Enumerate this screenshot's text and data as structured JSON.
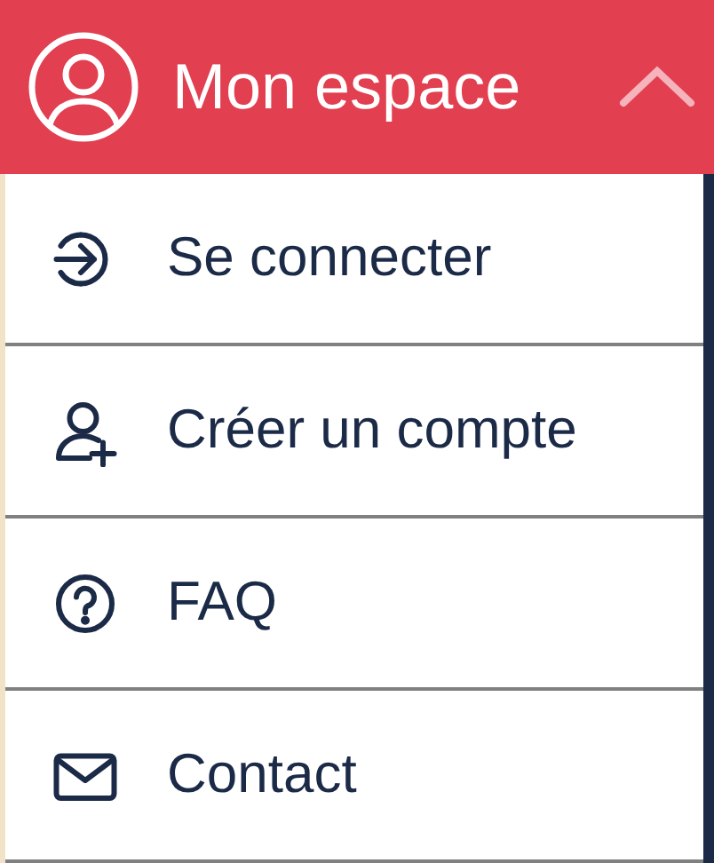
{
  "header": {
    "title": "Mon espace",
    "expanded": true
  },
  "menu": {
    "items": [
      {
        "label": "Se connecter"
      },
      {
        "label": "Créer un compte"
      },
      {
        "label": "FAQ"
      },
      {
        "label": "Contact"
      }
    ]
  }
}
